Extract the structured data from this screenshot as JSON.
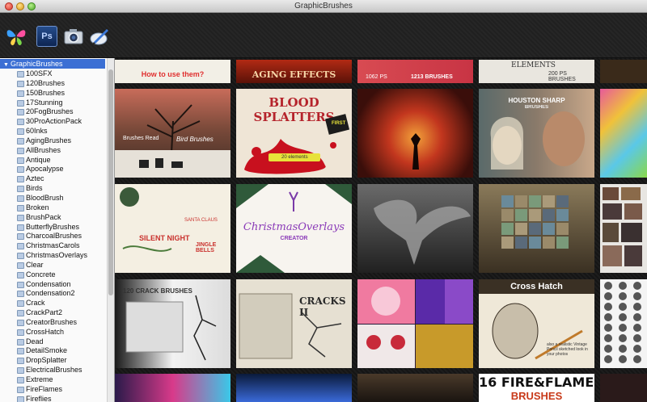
{
  "window": {
    "title": "GraphicBrushes"
  },
  "toolbar": {
    "icons": [
      "butterfly-icon",
      "photoshop-icon",
      "camera-icon",
      "brush-pen-icon"
    ],
    "ps_label": "Ps"
  },
  "sidebar": {
    "root": "GraphicBrushes",
    "items": [
      "100SFX",
      "120Brushes",
      "150Brushes",
      "17Stunning",
      "20FogBrushes",
      "30ProActionPack",
      "60Inks",
      "AgingBrushes",
      "AllBrushes",
      "Antique",
      "Apocalypse",
      "Aztec",
      "Birds",
      "BloodBrush",
      "Broken",
      "BrushPack",
      "ButterflyBrushes",
      "CharcoalBrushes",
      "ChristmasCarols",
      "ChristmasOverlays",
      "Clear",
      "Concrete",
      "Condensation",
      "Condensation2",
      "Crack",
      "CrackPart2",
      "CreatorBrushes",
      "CrossHatch",
      "Dead",
      "DetailSmoke",
      "DropSplatter",
      "ElectricalBrushes",
      "Extreme",
      "FireFlames",
      "Fireflies"
    ]
  },
  "gallery": {
    "texts": {
      "how_to_use": "How to use them?",
      "aging": "AGING EFFECTS",
      "ps_1062": "1062 PS",
      "ps_1213": "1213 BRUSHES",
      "elements_200": "ELEMENTS",
      "ps_brushes_200": "200 PS BRUSHES",
      "blood": "BLOOD",
      "splatters": "SPLATTERS",
      "first": "FIRST",
      "elements_20": "20 elements",
      "houston": "HOUSTON SHARP",
      "houston_sub": "BRUSHES",
      "christmas": "ChristmasOverlays",
      "creator": "CREATOR",
      "silent_night": "SILENT NIGHT",
      "jingle": "JINGLE BELLS",
      "santa": "SANTA CLAUS",
      "crack120": "120 CRACK BRUSHES",
      "cracks2": "CRACKS II",
      "cross_hatch": "Cross Hatch",
      "cross_hatch_sub": "also a realistic Vintage Pencil sketched look in your photos",
      "fire_flames": "16 FIRE&FLAMES",
      "fire_brushes": "BRUSHES",
      "bird": "Bird Brushes",
      "brushes_read": "Brushes Read"
    }
  }
}
